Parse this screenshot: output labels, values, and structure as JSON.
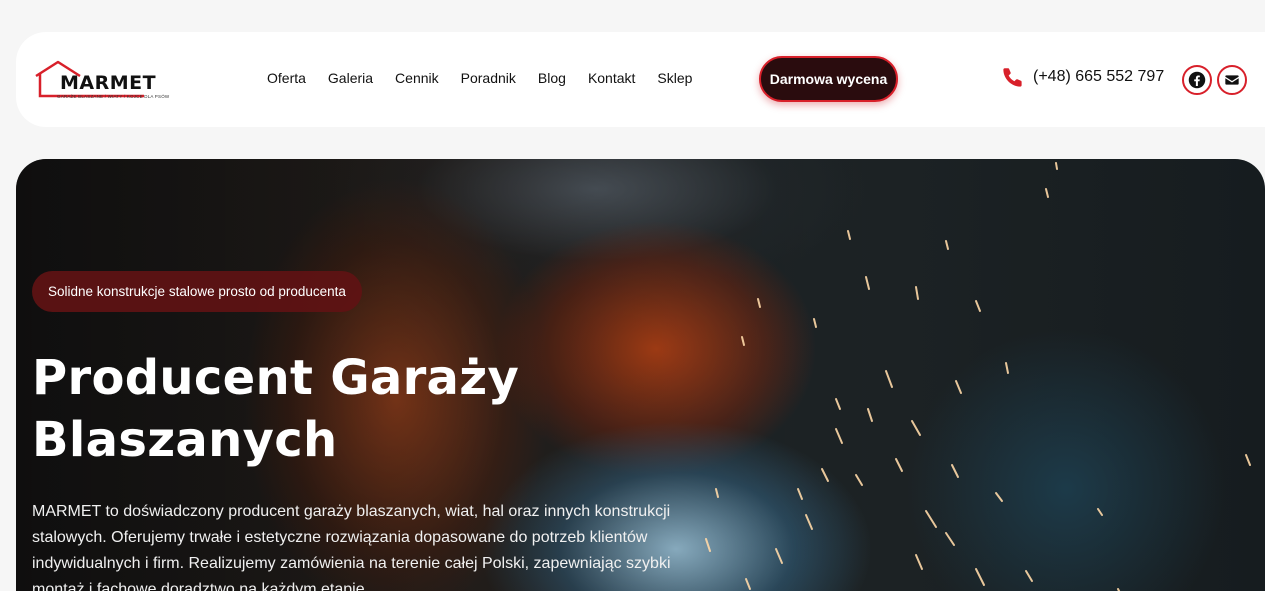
{
  "brand": {
    "name": "MARMET",
    "tagline": "GARAŻE BLASZANE / WIATY / KOJCE DLA PSÓW",
    "accent": "#d8202a"
  },
  "nav": {
    "items": [
      {
        "label": "Oferta"
      },
      {
        "label": "Galeria"
      },
      {
        "label": "Cennik"
      },
      {
        "label": "Poradnik"
      },
      {
        "label": "Blog"
      },
      {
        "label": "Kontakt"
      },
      {
        "label": "Sklep"
      }
    ]
  },
  "header": {
    "cta_label": "Darmowa wycena",
    "phone": "(+48) 665 552 797",
    "phone_icon": "phone-icon",
    "social": [
      {
        "icon": "facebook-icon"
      },
      {
        "icon": "envelope-icon"
      }
    ]
  },
  "hero": {
    "badge": "Solidne konstrukcje stalowe prosto od producenta",
    "title": "Producent Garaży Blaszanych",
    "text": "MARMET to doświadczony producent garaży blaszanych, wiat, hal oraz innych konstrukcji stalowych. Oferujemy trwałe i estetyczne rozwiązania dopasowane do potrzeb klientów indywidualnych i firm. Realizujemy zamówienia na terenie całej Polski, zapewniając szybki montaż i fachowe doradztwo na każdym etapie."
  }
}
